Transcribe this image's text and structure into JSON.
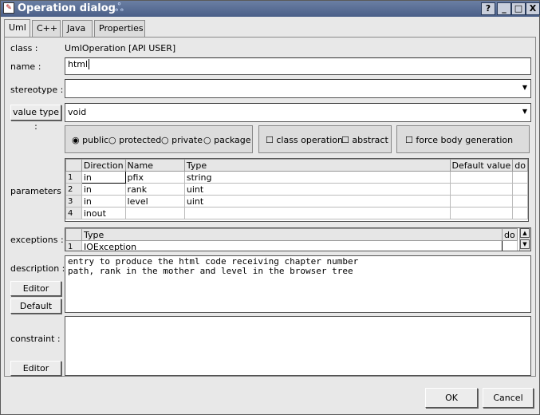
{
  "window": {
    "title": "Operation dialog",
    "help": "?",
    "minimize": "_",
    "maximize": "□",
    "close": "X"
  },
  "tabs": [
    {
      "label": "Uml"
    },
    {
      "label": "C++"
    },
    {
      "label": "Java"
    },
    {
      "label": "Properties"
    }
  ],
  "class_row": {
    "label": "class :",
    "value": "UmlOperation   [API USER]"
  },
  "name_row": {
    "label": "name :",
    "value": "html"
  },
  "stereotype_row": {
    "label": "stereotype :",
    "value": ""
  },
  "value_type_row": {
    "button": "value type :",
    "value": "void"
  },
  "visibility": {
    "options": [
      "public",
      "protected",
      "private",
      "package"
    ],
    "selected": "public"
  },
  "modifiers": {
    "class_operation": "class operation",
    "abstract": "abstract"
  },
  "force_body": {
    "label": "force body generation"
  },
  "parameters": {
    "label": "parameters :",
    "columns": [
      "",
      "Direction",
      "Name",
      "Type",
      "Default value",
      "do"
    ],
    "rows": [
      {
        "n": "1",
        "direction": "in",
        "name": "pfix",
        "type": "string",
        "default": "",
        "do": ""
      },
      {
        "n": "2",
        "direction": "in",
        "name": "rank",
        "type": "uint",
        "default": "",
        "do": ""
      },
      {
        "n": "3",
        "direction": "in",
        "name": "level",
        "type": "uint",
        "default": "",
        "do": ""
      },
      {
        "n": "4",
        "direction": "inout",
        "name": "",
        "type": "",
        "default": "",
        "do": ""
      }
    ]
  },
  "exceptions": {
    "label": "exceptions :",
    "columns": [
      "",
      "Type",
      "do"
    ],
    "rows": [
      {
        "n": "1",
        "type": "IOException",
        "do": ""
      }
    ]
  },
  "description": {
    "label": "description :",
    "text": "entry to produce the html code receiving chapter number\npath, rank in the mother and level in the browser tree",
    "editor_button": "Editor",
    "default_button": "Default"
  },
  "constraint": {
    "label": "constraint :",
    "text": "",
    "editor_button": "Editor"
  },
  "footer": {
    "ok": "OK",
    "cancel": "Cancel"
  }
}
